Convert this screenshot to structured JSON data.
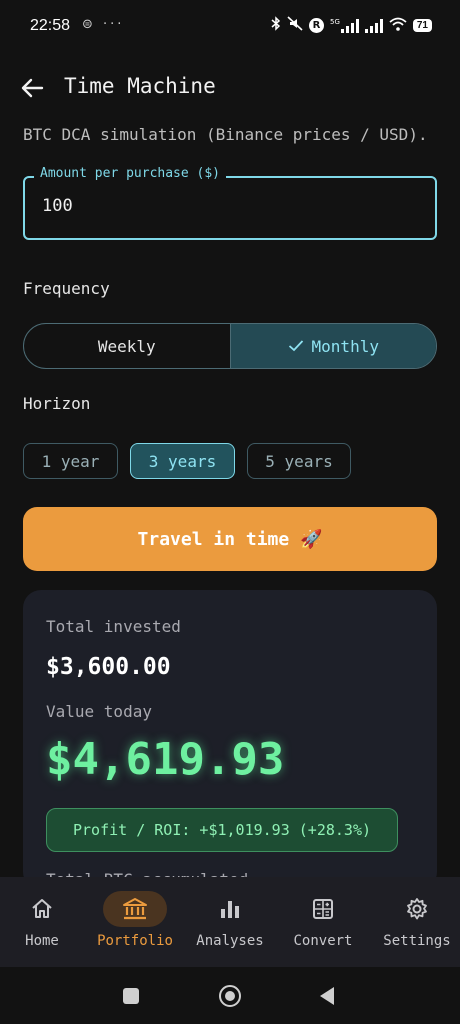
{
  "status_bar": {
    "time": "22:58",
    "left_icons": "⊜ ···",
    "r_badge": "R",
    "network": "5G",
    "battery": "71"
  },
  "header": {
    "title": "Time Machine",
    "subtitle": "BTC DCA simulation (Binance prices / USD)."
  },
  "amount": {
    "label": "Amount per purchase ($)",
    "value": "100"
  },
  "frequency": {
    "label": "Frequency",
    "options": [
      "Weekly",
      "Monthly"
    ],
    "selected": "Monthly"
  },
  "horizon": {
    "label": "Horizon",
    "options": [
      "1 year",
      "3 years",
      "5 years"
    ],
    "selected": "3 years"
  },
  "cta": {
    "label": "Travel in time 🚀"
  },
  "results": {
    "invested_label": "Total invested",
    "invested_value": "$3,600.00",
    "value_label": "Value today",
    "value_today": "$4,619.93",
    "profit": "Profit / ROI: +$1,019.93 (+28.3%)",
    "btc_label": "Total BTC accumulated"
  },
  "bottom_nav": {
    "items": [
      {
        "label": "Home",
        "icon": "home-icon"
      },
      {
        "label": "Portfolio",
        "icon": "bank-icon"
      },
      {
        "label": "Analyses",
        "icon": "bar-chart-icon"
      },
      {
        "label": "Convert",
        "icon": "calculator-icon"
      },
      {
        "label": "Settings",
        "icon": "gear-icon"
      }
    ],
    "active": "Portfolio"
  },
  "colors": {
    "accent": "#7fd8e8",
    "cta": "#eb9b3e",
    "profit": "#6ef0a0",
    "background": "#121212"
  }
}
